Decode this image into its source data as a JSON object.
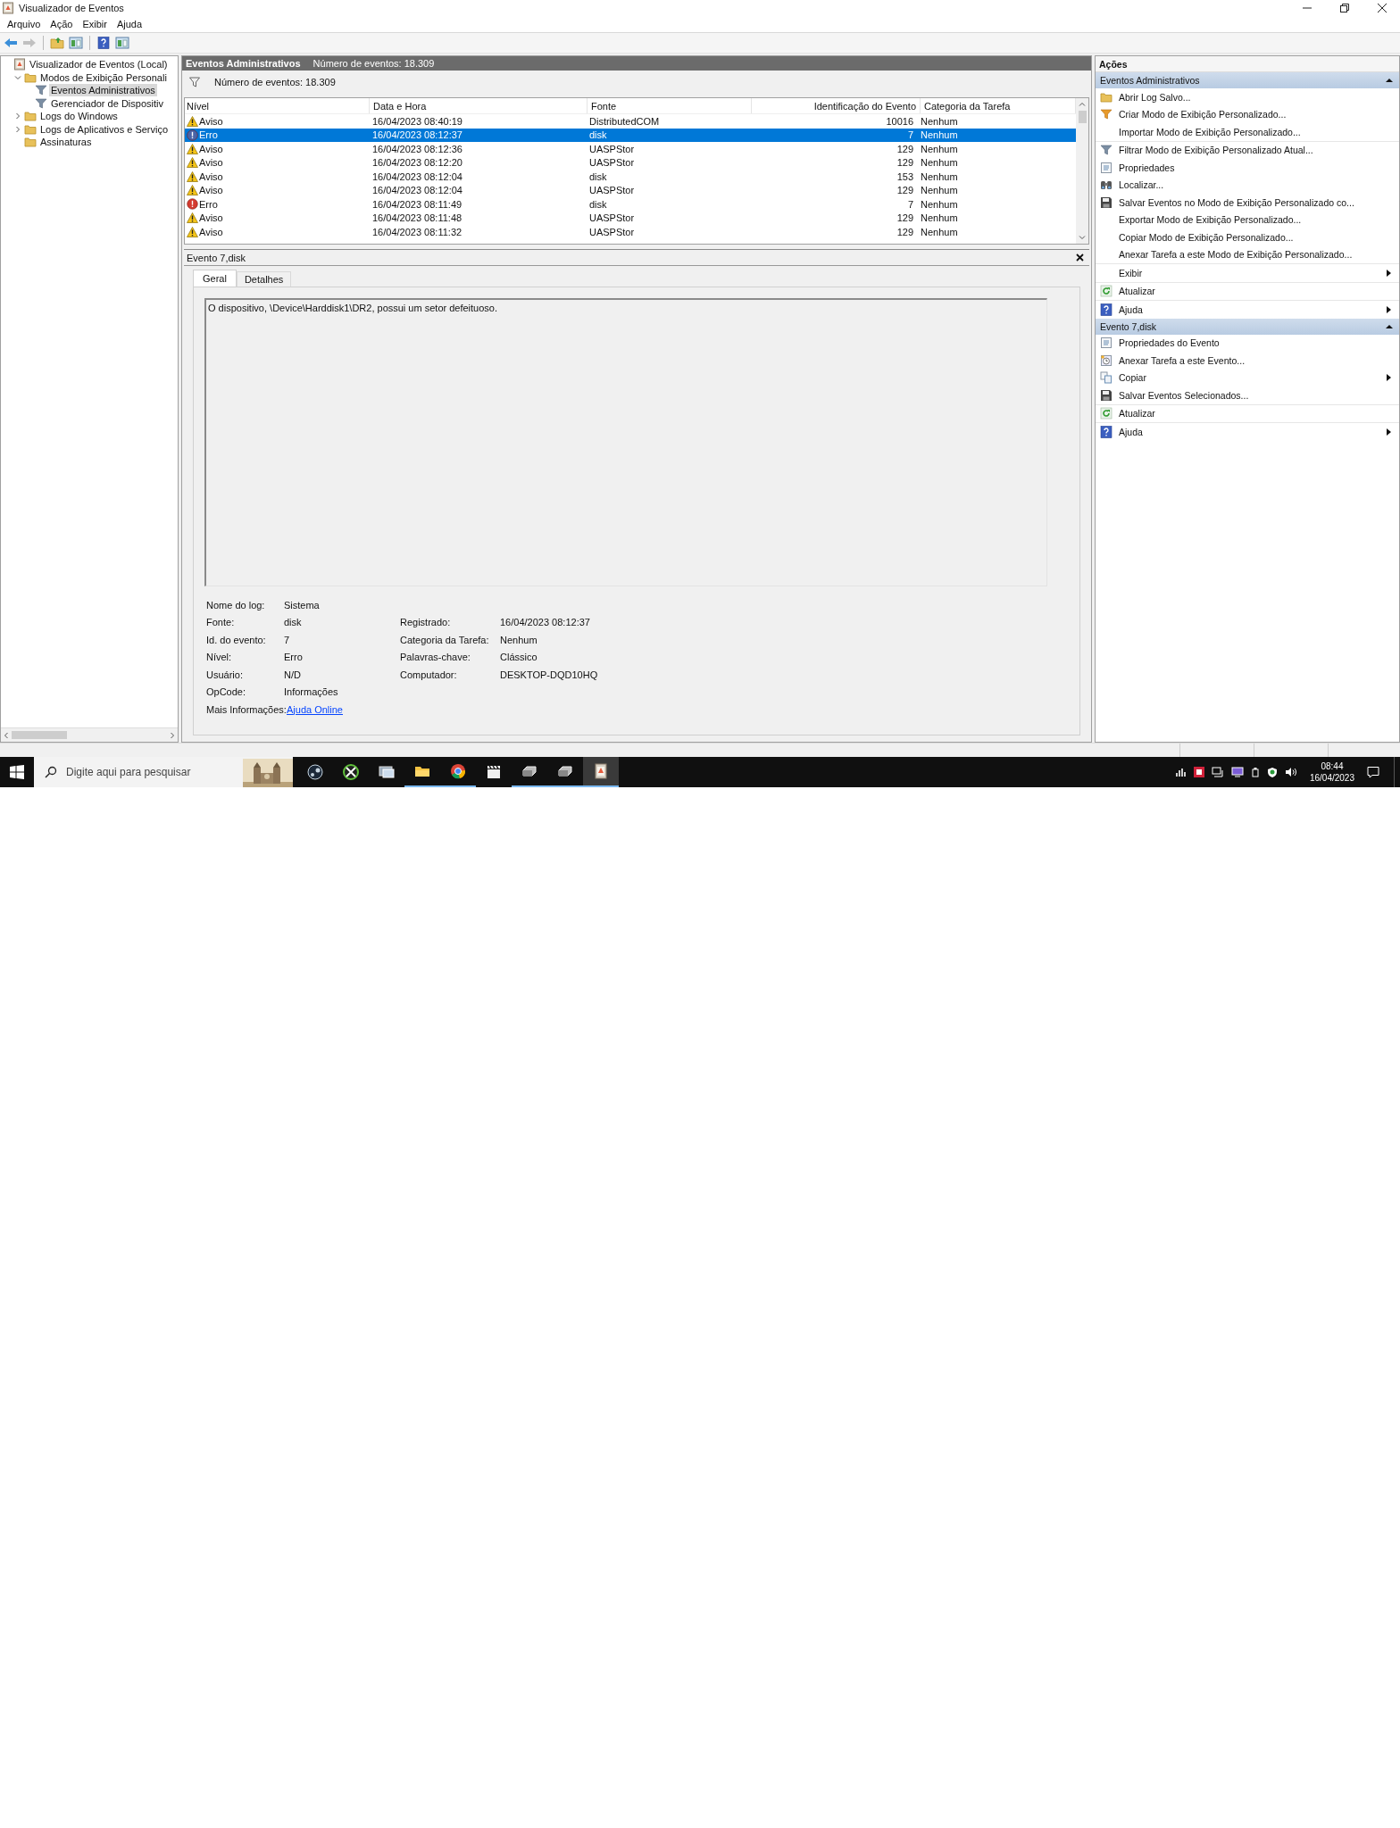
{
  "window": {
    "title": "Visualizador de Eventos"
  },
  "menu": [
    "Arquivo",
    "Ação",
    "Exibir",
    "Ajuda"
  ],
  "toolbar": [
    {
      "kind": "back",
      "disabled": false
    },
    {
      "kind": "forward",
      "disabled": true
    },
    {
      "kind": "folder-up",
      "disabled": false
    },
    {
      "kind": "pane",
      "disabled": false
    },
    {
      "kind": "help",
      "disabled": false
    },
    {
      "kind": "pane",
      "disabled": false
    }
  ],
  "tree": [
    {
      "label": "Visualizador de Eventos (Local)",
      "kind": "log",
      "selected": false,
      "children": [
        {
          "label": "Modos de Exibição Personali",
          "kind": "folder",
          "expanded": true,
          "selected": false,
          "children": [
            {
              "label": "Eventos Administrativos",
              "kind": "filter",
              "selected": true
            },
            {
              "label": "Gerenciador de Dispositiv",
              "kind": "filter",
              "selected": false
            }
          ]
        },
        {
          "label": "Logs do Windows",
          "kind": "folder",
          "expanded": false,
          "selected": false
        },
        {
          "label": "Logs de Aplicativos e Serviço",
          "kind": "folder",
          "expanded": false,
          "selected": false
        },
        {
          "label": "Assinaturas",
          "kind": "folder",
          "selected": false
        }
      ]
    }
  ],
  "view": {
    "title": "Eventos Administrativos",
    "count": "Número de eventos: 18.309",
    "filter_text": "Número de eventos: 18.309"
  },
  "table": {
    "columns": [
      "Nível",
      "Data e Hora",
      "Fonte",
      "Identificação do Evento",
      "Categoria da Tarefa"
    ],
    "rows": [
      {
        "kind": "warning",
        "level": "Aviso",
        "date": "16/04/2023 08:40:19",
        "source": "DistributedCOM",
        "id": "10016",
        "category": "Nenhum",
        "selected": false
      },
      {
        "kind": "error",
        "level": "Erro",
        "date": "16/04/2023 08:12:37",
        "source": "disk",
        "id": "7",
        "category": "Nenhum",
        "selected": true
      },
      {
        "kind": "warning",
        "level": "Aviso",
        "date": "16/04/2023 08:12:36",
        "source": "UASPStor",
        "id": "129",
        "category": "Nenhum",
        "selected": false
      },
      {
        "kind": "warning",
        "level": "Aviso",
        "date": "16/04/2023 08:12:20",
        "source": "UASPStor",
        "id": "129",
        "category": "Nenhum",
        "selected": false
      },
      {
        "kind": "warning",
        "level": "Aviso",
        "date": "16/04/2023 08:12:04",
        "source": "disk",
        "id": "153",
        "category": "Nenhum",
        "selected": false
      },
      {
        "kind": "warning",
        "level": "Aviso",
        "date": "16/04/2023 08:12:04",
        "source": "UASPStor",
        "id": "129",
        "category": "Nenhum",
        "selected": false
      },
      {
        "kind": "error",
        "level": "Erro",
        "date": "16/04/2023 08:11:49",
        "source": "disk",
        "id": "7",
        "category": "Nenhum",
        "selected": false
      },
      {
        "kind": "warning",
        "level": "Aviso",
        "date": "16/04/2023 08:11:48",
        "source": "UASPStor",
        "id": "129",
        "category": "Nenhum",
        "selected": false
      },
      {
        "kind": "warning",
        "level": "Aviso",
        "date": "16/04/2023 08:11:32",
        "source": "UASPStor",
        "id": "129",
        "category": "Nenhum",
        "selected": false
      }
    ]
  },
  "detail": {
    "title": "Evento 7,disk",
    "tabs": [
      {
        "label": "Geral",
        "selected": true
      },
      {
        "label": "Detalhes",
        "selected": false
      }
    ],
    "message": "O dispositivo, \\Device\\Harddisk1\\DR2, possui um setor defeituoso.",
    "fields": [
      {
        "label": "Nome do log:",
        "value": "Sistema"
      },
      {
        "label": "Fonte:",
        "value": "disk"
      },
      {
        "label": "Id. do evento:",
        "value": "7"
      },
      {
        "label": "Nível:",
        "value": "Erro"
      },
      {
        "label": "Usuário:",
        "value": "N/D"
      },
      {
        "label": "OpCode:",
        "value": "Informações"
      }
    ],
    "fields_right": [
      {
        "label": "Registrado:",
        "value": "16/04/2023 08:12:37"
      },
      {
        "label": "Categoria da Tarefa:",
        "value": "Nenhum"
      },
      {
        "label": "Palavras-chave:",
        "value": "Clássico"
      },
      {
        "label": "Computador:",
        "value": "DESKTOP-DQD10HQ"
      }
    ],
    "more_info": {
      "label": "Mais Informações:",
      "link": "Ajuda Online"
    }
  },
  "actions": {
    "title": "Ações",
    "sections": [
      {
        "title": "Eventos Administrativos",
        "expanded": true,
        "groups": [
          [
            {
              "label": "Abrir Log Salvo...",
              "kind": "folder"
            },
            {
              "label": "Criar Modo de Exibição Personalizado...",
              "kind": "filter-new"
            },
            {
              "label": "Importar Modo de Exibição Personalizado..."
            }
          ],
          [
            {
              "label": "Filtrar Modo de Exibição Personalizado Atual...",
              "kind": "filter"
            },
            {
              "label": "Propriedades",
              "kind": "properties"
            },
            {
              "label": "Localizar...",
              "kind": "binoculars"
            },
            {
              "label": "Salvar Eventos no Modo de Exibição Personalizado co...",
              "kind": "save"
            },
            {
              "label": "Exportar Modo de Exibição Personalizado..."
            },
            {
              "label": "Copiar Modo de Exibição Personalizado..."
            },
            {
              "label": "Anexar Tarefa a este Modo de Exibição Personalizado..."
            }
          ],
          [
            {
              "label": "Exibir",
              "submenu": true
            }
          ],
          [
            {
              "label": "Atualizar",
              "kind": "refresh"
            }
          ],
          [
            {
              "label": "Ajuda",
              "kind": "help",
              "submenu": true
            }
          ]
        ]
      },
      {
        "title": "Evento 7,disk",
        "expanded": true,
        "groups": [
          [
            {
              "label": "Propriedades do Evento",
              "kind": "properties"
            },
            {
              "label": "Anexar Tarefa a este Evento...",
              "kind": "task"
            },
            {
              "label": "Copiar",
              "kind": "copy",
              "submenu": true
            },
            {
              "label": "Salvar Eventos Selecionados...",
              "kind": "save"
            }
          ],
          [
            {
              "label": "Atualizar",
              "kind": "refresh"
            }
          ],
          [
            {
              "label": "Ajuda",
              "kind": "help",
              "submenu": true
            }
          ]
        ]
      }
    ]
  },
  "taskbar": {
    "search_placeholder": "Digite aqui para pesquisar",
    "apps": [
      {
        "kind": "dark-circle",
        "running": false,
        "active": false
      },
      {
        "kind": "green-circle",
        "running": false,
        "active": false
      },
      {
        "kind": "monitor",
        "running": false,
        "active": false
      },
      {
        "kind": "folder",
        "running": true,
        "active": false
      },
      {
        "kind": "browser",
        "running": true,
        "active": false
      },
      {
        "kind": "clapper",
        "running": false,
        "active": false
      },
      {
        "kind": "drive",
        "running": true,
        "active": false
      },
      {
        "kind": "drive",
        "running": true,
        "active": false
      },
      {
        "kind": "log",
        "running": true,
        "active": true
      }
    ],
    "time": "08:44",
    "date": "16/04/2023"
  }
}
